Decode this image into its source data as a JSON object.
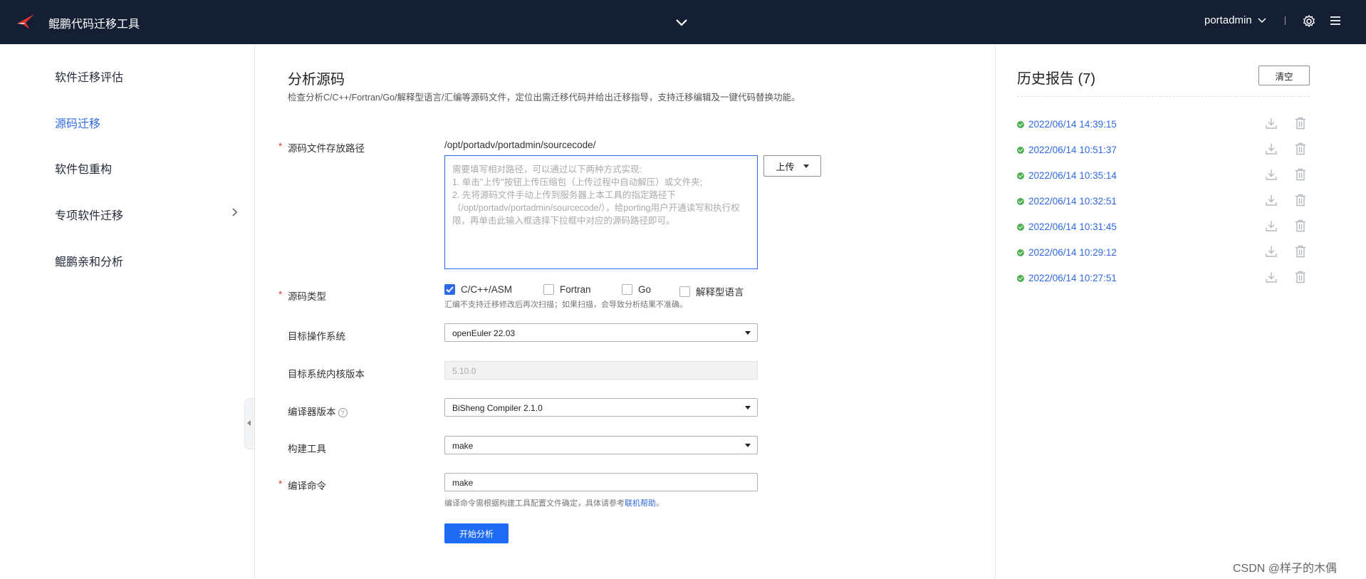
{
  "app": {
    "title": "鲲鹏代码迁移工具",
    "user": "portadmin"
  },
  "sidebar": {
    "items": [
      {
        "label": "软件迁移评估",
        "active": false
      },
      {
        "label": "源码迁移",
        "active": true
      },
      {
        "label": "软件包重构",
        "active": false
      },
      {
        "label": "专项软件迁移",
        "active": false,
        "has_arrow": true
      },
      {
        "label": "鲲鹏亲和分析",
        "active": false
      }
    ]
  },
  "main": {
    "title": "分析源码",
    "description": "检查分析C/C++/Fortran/Go/解释型语言/汇编等源码文件，定位出需迁移代码并给出迁移指导，支持迁移编辑及一键代码替换功能。",
    "source_path": {
      "label": "源码文件存放路径",
      "base_path": "/opt/portadv/portadmin/sourcecode/",
      "placeholder": "需要填写相对路径，可以通过以下两种方式实现:\n1. 单击\"上传\"按钮上传压缩包（上传过程中自动解压）或文件夹;\n2. 先将源码文件手动上传到服务器上本工具的指定路径下（/opt/portadv/portadmin/sourcecode/），给porting用户开通读写和执行权限，再单击此输入框选择下拉框中对应的源码路径即可。",
      "upload_label": "上传"
    },
    "source_type": {
      "label": "源码类型",
      "options": [
        {
          "label": "C/C++/ASM",
          "checked": true
        },
        {
          "label": "Fortran",
          "checked": false
        },
        {
          "label": "Go",
          "checked": false
        },
        {
          "label": "解释型语言",
          "checked": false
        }
      ],
      "hint": "汇编不支持迁移修改后再次扫描；如果扫描，会导致分析结果不准确。"
    },
    "target_os": {
      "label": "目标操作系统",
      "value": "openEuler 22.03"
    },
    "kernel": {
      "label": "目标系统内核版本",
      "value": "5.10.0"
    },
    "compiler": {
      "label": "编译器版本",
      "value": "BiSheng Compiler 2.1.0"
    },
    "build_tool": {
      "label": "构建工具",
      "value": "make"
    },
    "build_cmd": {
      "label": "编译命令",
      "value": "make",
      "hint_prefix": "编译命令需根据构建工具配置文件确定，具体请参考",
      "hint_link": "联机帮助",
      "hint_suffix": "。"
    },
    "start_label": "开始分析"
  },
  "history": {
    "title": "历史报告 (7)",
    "clear_label": "清空",
    "reports": [
      "2022/06/14 14:39:15",
      "2022/06/14 10:51:37",
      "2022/06/14 10:35:14",
      "2022/06/14 10:32:51",
      "2022/06/14 10:31:45",
      "2022/06/14 10:29:12",
      "2022/06/14 10:27:51"
    ]
  },
  "watermark": "CSDN @样子的木偶",
  "colors": {
    "topbar": "#141f33",
    "accent": "#2f6ae6",
    "primary_button": "#1e6cf3",
    "success": "#4caf50",
    "required": "#e54545"
  }
}
